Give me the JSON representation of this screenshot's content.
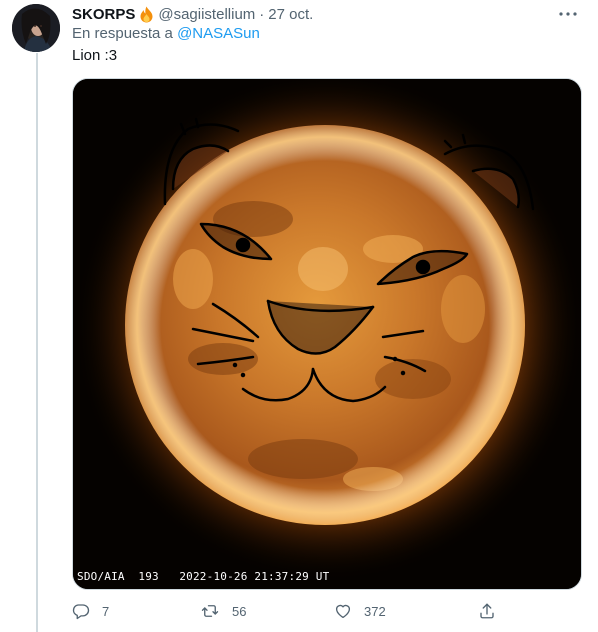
{
  "tweet": {
    "author": {
      "display_name": "SKORPS",
      "handle": "@sagiistellium",
      "separator": "·",
      "date": "27 oct.",
      "badge_icon": "fire-emoji-icon"
    },
    "reply_prefix": "En respuesta a",
    "reply_to": "@NASASun",
    "text": "Lion :3",
    "media": {
      "alt": "Sun image with drawn lion face",
      "caption": "SDO/AIA  193   2022-10-26 21:37:29 UT"
    },
    "actions": {
      "reply_count": "7",
      "retweet_count": "56",
      "like_count": "372"
    },
    "icons": {
      "more": "more-dots-icon",
      "reply": "reply-bubble-icon",
      "retweet": "retweet-icon",
      "like": "heart-icon",
      "share": "share-upload-icon"
    },
    "colors": {
      "link": "#1d9bf0",
      "muted": "#536471",
      "text": "#0f1419",
      "divider": "#cfd9de"
    }
  }
}
